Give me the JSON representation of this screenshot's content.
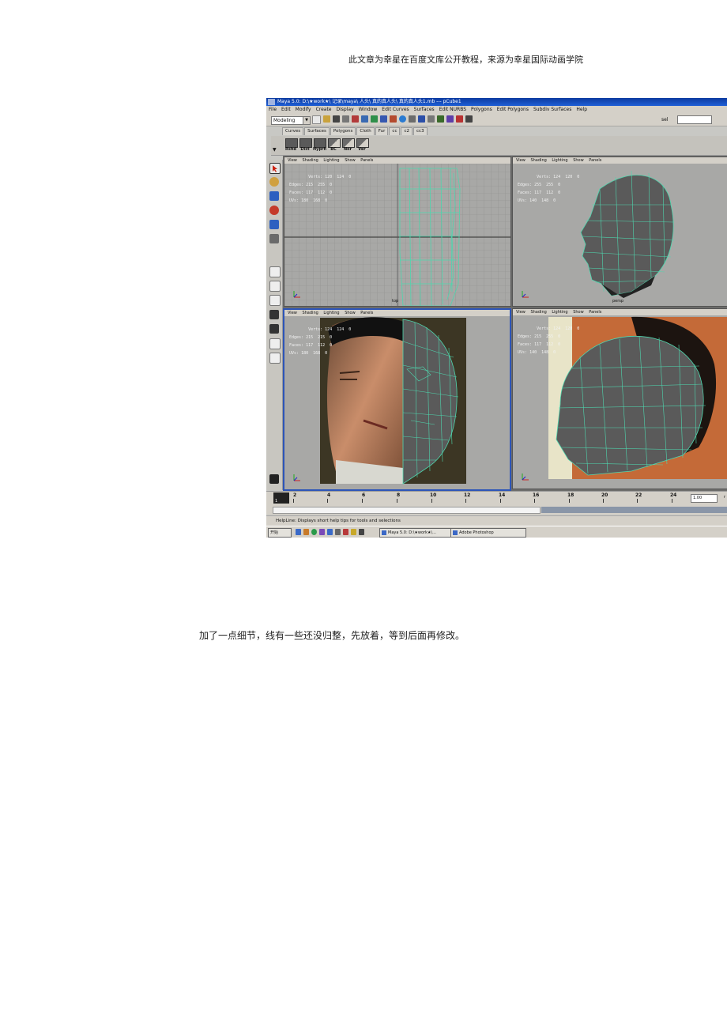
{
  "document": {
    "header_note": "此文章为幸星在百度文库公开教程，来源为幸星国际动画学院",
    "caption": "加了一点细节，线有一些还没归整，先放着，等到后面再修改。"
  },
  "screenshot": {
    "window_title": "Maya 5.0: D:\\★work★\\ 记录\\maya\\ 人头\\ 真的真人头\\ 真的真人头1.mb  ---  pCube1",
    "menus": [
      "File",
      "Edit",
      "Modify",
      "Create",
      "Display",
      "Window",
      "Edit Curves",
      "Surfaces",
      "Edit NURBS",
      "Polygons",
      "Edit Polygons",
      "Subdiv Surfaces",
      "Help"
    ],
    "mode": "Modeling",
    "select_label": "sel",
    "shelf_tabs": [
      "Curves",
      "Surfaces",
      "Polygons",
      "Cloth",
      "Fur",
      "cc",
      "c2",
      "cc3"
    ],
    "shelf_buttons": [
      "Rshd",
      "Dist",
      "Hyprh",
      "BC",
      "Nor",
      "Ver"
    ],
    "viewport_menu": [
      "View",
      "Shading",
      "Lighting",
      "Show",
      "Panels"
    ],
    "stats": {
      "labels": [
        "Verts:",
        "Edges:",
        "Faces:",
        "UVs:"
      ],
      "top": [
        "120  124  0",
        "215  255  0",
        "117  112  0",
        "180  168  0"
      ],
      "persp": [
        "124  120  0",
        "255  255  0",
        "117  112  0",
        "140  148  0"
      ],
      "front": [
        "124  124  0",
        "215  215  0",
        "117  112  0",
        "180  168  0"
      ],
      "side": [
        "124  120  0",
        "215  255  0",
        "117  112  0",
        "140  148  0"
      ]
    },
    "cameras": {
      "top": "top",
      "persp": "persp"
    },
    "timeline": {
      "current_frame": "1",
      "ticks": [
        "2",
        "4",
        "6",
        "8",
        "10",
        "12",
        "14",
        "16",
        "18",
        "20",
        "22",
        "24"
      ],
      "time_value": "1.00",
      "time_suffix": "r"
    },
    "helpline": "HelpLine: Displays short help tips for tools and selections",
    "taskbar": {
      "start": "开始",
      "items": [
        "Maya 5.0: D:\\★work★\\...",
        "Adobe Photoshop"
      ]
    },
    "colors": {
      "mesh_wire": "#4fd6ae",
      "mesh_fill": "#5a5a5a",
      "viewport_bg": "#a8a8a6",
      "title_blue": "#1f5fd6"
    }
  }
}
